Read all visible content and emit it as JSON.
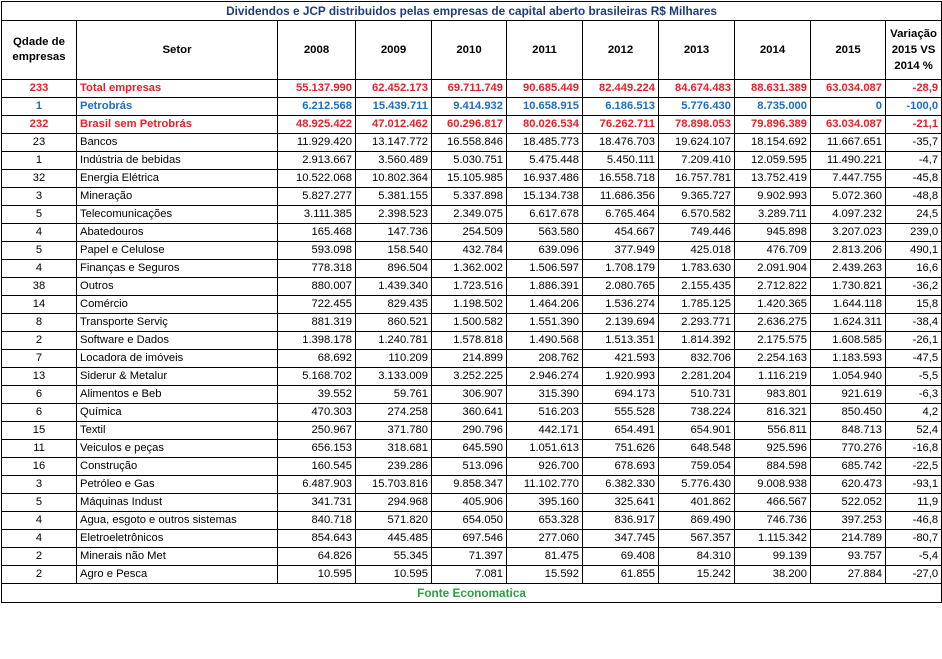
{
  "title": "Dividendos e JCP distribuidos pelas empresas de capital aberto brasileiras R$ Milhares",
  "footer": "Fonte Economatica",
  "headers": {
    "qdade_line1": "Qdade de",
    "qdade_line2": "empresas",
    "setor": "Setor",
    "years": [
      "2008",
      "2009",
      "2010",
      "2011",
      "2012",
      "2013",
      "2014",
      "2015"
    ],
    "var_line1": "Variação",
    "var_line2": "2015 VS",
    "var_line3": "2014 %"
  },
  "colors": {
    "title": "#1f3c7a",
    "total_rows": "#e8202a",
    "petrobras_row": "#1b6ec2",
    "footer": "#2aa040"
  },
  "rows": [
    {
      "style": "red",
      "q": "233",
      "setor": "Total empresas",
      "vals": [
        "55.137.990",
        "62.452.173",
        "69.711.749",
        "90.685.449",
        "82.449.224",
        "84.674.483",
        "88.631.389",
        "63.034.087"
      ],
      "var": "-28,9"
    },
    {
      "style": "blue",
      "q": "1",
      "setor": "Petrobrás",
      "vals": [
        "6.212.568",
        "15.439.711",
        "9.414.932",
        "10.658.915",
        "6.186.513",
        "5.776.430",
        "8.735.000",
        "0"
      ],
      "var": "-100,0"
    },
    {
      "style": "red",
      "q": "232",
      "setor": "Brasil sem Petrobrás",
      "vals": [
        "48.925.422",
        "47.012.462",
        "60.296.817",
        "80.026.534",
        "76.262.711",
        "78.898.053",
        "79.896.389",
        "63.034.087"
      ],
      "var": "-21,1"
    },
    {
      "style": "",
      "q": "23",
      "setor": "Bancos",
      "vals": [
        "11.929.420",
        "13.147.772",
        "16.558.846",
        "18.485.773",
        "18.476.703",
        "19.624.107",
        "18.154.692",
        "11.667.651"
      ],
      "var": "-35,7"
    },
    {
      "style": "",
      "q": "1",
      "setor": "Indústria de bebidas",
      "vals": [
        "2.913.667",
        "3.560.489",
        "5.030.751",
        "5.475.448",
        "5.450.111",
        "7.209.410",
        "12.059.595",
        "11.490.221"
      ],
      "var": "-4,7"
    },
    {
      "style": "",
      "q": "32",
      "setor": "Energia Elétrica",
      "vals": [
        "10.522.068",
        "10.802.364",
        "15.105.985",
        "16.937.486",
        "16.558.718",
        "16.757.781",
        "13.752.419",
        "7.447.755"
      ],
      "var": "-45,8"
    },
    {
      "style": "",
      "q": "3",
      "setor": "Mineração",
      "vals": [
        "5.827.277",
        "5.381.155",
        "5.337.898",
        "15.134.738",
        "11.686.356",
        "9.365.727",
        "9.902.993",
        "5.072.360"
      ],
      "var": "-48,8"
    },
    {
      "style": "",
      "q": "5",
      "setor": "Telecomunicações",
      "vals": [
        "3.111.385",
        "2.398.523",
        "2.349.075",
        "6.617.678",
        "6.765.464",
        "6.570.582",
        "3.289.711",
        "4.097.232"
      ],
      "var": "24,5"
    },
    {
      "style": "",
      "q": "4",
      "setor": "Abatedouros",
      "vals": [
        "165.468",
        "147.736",
        "254.509",
        "563.580",
        "454.667",
        "749.446",
        "945.898",
        "3.207.023"
      ],
      "var": "239,0"
    },
    {
      "style": "",
      "q": "5",
      "setor": "Papel e Celulose",
      "vals": [
        "593.098",
        "158.540",
        "432.784",
        "639.096",
        "377.949",
        "425.018",
        "476.709",
        "2.813.206"
      ],
      "var": "490,1"
    },
    {
      "style": "",
      "q": "4",
      "setor": "Finanças e Seguros",
      "vals": [
        "778.318",
        "896.504",
        "1.362.002",
        "1.506.597",
        "1.708.179",
        "1.783.630",
        "2.091.904",
        "2.439.263"
      ],
      "var": "16,6"
    },
    {
      "style": "",
      "q": "38",
      "setor": "Outros",
      "vals": [
        "880.007",
        "1.439.340",
        "1.723.516",
        "1.886.391",
        "2.080.765",
        "2.155.435",
        "2.712.822",
        "1.730.821"
      ],
      "var": "-36,2"
    },
    {
      "style": "",
      "q": "14",
      "setor": "Comércio",
      "vals": [
        "722.455",
        "829.435",
        "1.198.502",
        "1.464.206",
        "1.536.274",
        "1.785.125",
        "1.420.365",
        "1.644.118"
      ],
      "var": "15,8"
    },
    {
      "style": "",
      "q": "8",
      "setor": "Transporte Serviç",
      "vals": [
        "881.319",
        "860.521",
        "1.500.582",
        "1.551.390",
        "2.139.694",
        "2.293.771",
        "2.636.275",
        "1.624.311"
      ],
      "var": "-38,4"
    },
    {
      "style": "",
      "q": "2",
      "setor": "Software e Dados",
      "vals": [
        "1.398.178",
        "1.240.781",
        "1.578.818",
        "1.490.568",
        "1.513.351",
        "1.814.392",
        "2.175.575",
        "1.608.585"
      ],
      "var": "-26,1"
    },
    {
      "style": "",
      "q": "7",
      "setor": "Locadora de imóveis",
      "vals": [
        "68.692",
        "110.209",
        "214.899",
        "208.762",
        "421.593",
        "832.706",
        "2.254.163",
        "1.183.593"
      ],
      "var": "-47,5"
    },
    {
      "style": "",
      "q": "13",
      "setor": "Siderur & Metalur",
      "vals": [
        "5.168.702",
        "3.133.009",
        "3.252.225",
        "2.946.274",
        "1.920.993",
        "2.281.204",
        "1.116.219",
        "1.054.940"
      ],
      "var": "-5,5"
    },
    {
      "style": "",
      "q": "6",
      "setor": "Alimentos e Beb",
      "vals": [
        "39.552",
        "59.761",
        "306.907",
        "315.390",
        "694.173",
        "510.731",
        "983.801",
        "921.619"
      ],
      "var": "-6,3"
    },
    {
      "style": "",
      "q": "6",
      "setor": "Química",
      "vals": [
        "470.303",
        "274.258",
        "360.641",
        "516.203",
        "555.528",
        "738.224",
        "816.321",
        "850.450"
      ],
      "var": "4,2"
    },
    {
      "style": "",
      "q": "15",
      "setor": "Textil",
      "vals": [
        "250.967",
        "371.780",
        "290.796",
        "442.171",
        "654.491",
        "654.901",
        "556.811",
        "848.713"
      ],
      "var": "52,4"
    },
    {
      "style": "",
      "q": "11",
      "setor": "Veiculos e peças",
      "vals": [
        "656.153",
        "318.681",
        "645.590",
        "1.051.613",
        "751.626",
        "648.548",
        "925.596",
        "770.276"
      ],
      "var": "-16,8"
    },
    {
      "style": "",
      "q": "16",
      "setor": "Construção",
      "vals": [
        "160.545",
        "239.286",
        "513.096",
        "926.700",
        "678.693",
        "759.054",
        "884.598",
        "685.742"
      ],
      "var": "-22,5"
    },
    {
      "style": "",
      "q": "3",
      "setor": "Petróleo e Gas",
      "vals": [
        "6.487.903",
        "15.703.816",
        "9.858.347",
        "11.102.770",
        "6.382.330",
        "5.776.430",
        "9.008.938",
        "620.473"
      ],
      "var": "-93,1"
    },
    {
      "style": "",
      "q": "5",
      "setor": "Máquinas Indust",
      "vals": [
        "341.731",
        "294.968",
        "405.906",
        "395.160",
        "325.641",
        "401.862",
        "466.567",
        "522.052"
      ],
      "var": "11,9"
    },
    {
      "style": "",
      "q": "4",
      "setor": "Agua, esgoto e outros sistemas",
      "vals": [
        "840.718",
        "571.820",
        "654.050",
        "653.328",
        "836.917",
        "869.490",
        "746.736",
        "397.253"
      ],
      "var": "-46,8"
    },
    {
      "style": "",
      "q": "4",
      "setor": "Eletroeletrônicos",
      "vals": [
        "854.643",
        "445.485",
        "697.546",
        "277.060",
        "347.745",
        "567.357",
        "1.115.342",
        "214.789"
      ],
      "var": "-80,7"
    },
    {
      "style": "",
      "q": "2",
      "setor": "Minerais não Met",
      "vals": [
        "64.826",
        "55.345",
        "71.397",
        "81.475",
        "69.408",
        "84.310",
        "99.139",
        "93.757"
      ],
      "var": "-5,4"
    },
    {
      "style": "",
      "q": "2",
      "setor": "Agro e Pesca",
      "vals": [
        "10.595",
        "10.595",
        "7.081",
        "15.592",
        "61.855",
        "15.242",
        "38.200",
        "27.884"
      ],
      "var": "-27,0"
    }
  ]
}
